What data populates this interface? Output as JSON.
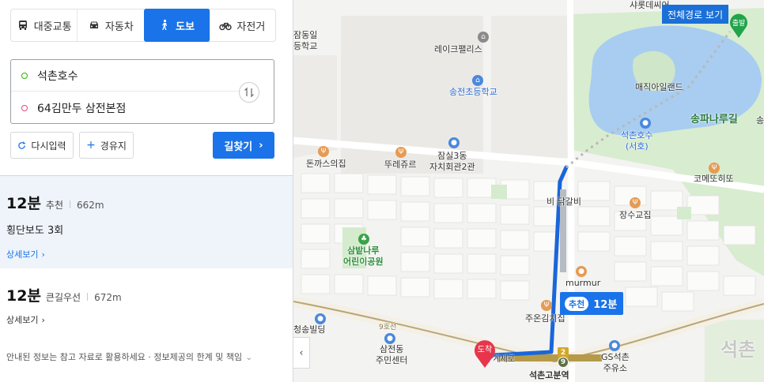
{
  "transport_modes": [
    {
      "label": "대중교통",
      "icon": "bus-icon"
    },
    {
      "label": "자동차",
      "icon": "car-icon"
    },
    {
      "label": "도보",
      "icon": "walk-icon",
      "active": true
    },
    {
      "label": "자전거",
      "icon": "bicycle-icon"
    }
  ],
  "route": {
    "start": "석촌호수",
    "end": "64김만두 삼전본점"
  },
  "buttons": {
    "reset": "다시입력",
    "waypoint": "경유지",
    "search": "길찾기"
  },
  "results": [
    {
      "time": "12분",
      "tag": "추천",
      "distance": "662m",
      "description": "횡단보도 3회",
      "detail": "상세보기"
    },
    {
      "time": "12분",
      "tag": "큰길우선",
      "distance": "672m",
      "detail": "상세보기"
    }
  ],
  "notice": "안내된 정보는 참고 자료로 활용하세요 · 정보제공의 한계 및 책임",
  "map": {
    "full_route_button": "전체경로 보기",
    "start_pin_label": "출발",
    "end_pin_label": "도착",
    "route_badge": {
      "tag": "추천",
      "time": "12분"
    },
    "collapse_arrow": "‹",
    "station_badge_1": "2",
    "station_badge_2": "9",
    "labels": {
      "lake_palace": "레이크팰리스",
      "songjeon_school": "송전초등학교",
      "jamsil3": "잠실3동\n자치회관2관",
      "donkatsu": "돈까스의집",
      "ttureju": "뚜레쥬르",
      "magic_island": "매직아일랜드",
      "songpa_naru": "송파나루길",
      "seokchon_lake": "석촌호수\n(서호)",
      "comeddo": "코메또히또",
      "dakgalbi": "비 닭갈비",
      "jangsu": "장수교집",
      "sambat": "삼밭나루\n어린이공원",
      "murmur": "murmur",
      "juon": "주온김치집",
      "cheongsong": "청송빌딩",
      "samjeon_center": "삼전동\n주민센터",
      "gs_station": "GS석촌\n주유소",
      "seokchon_gobun": "석촌고분역",
      "top_left": "잠동일\n등학교",
      "top_right": "샤롯데씨어",
      "big_bottom": "석촌",
      "road_9": "9호선",
      "songpa_right": "송",
      "near_end": "띠 계세로"
    }
  }
}
